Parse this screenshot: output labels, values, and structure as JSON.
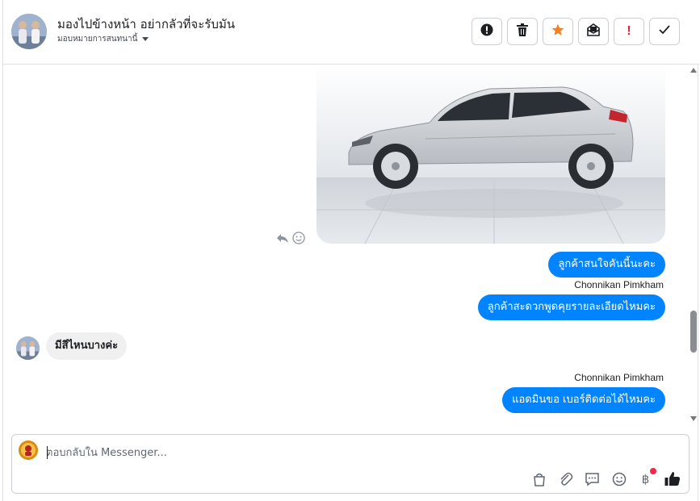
{
  "header": {
    "title": "มองไปข้างหน้า อย่ากลัวที่จะรับมัน",
    "subtitle": "มอบหมายการสนทนานี้",
    "actions": [
      {
        "name": "report-spam-button",
        "icon": "alert-circle-icon"
      },
      {
        "name": "delete-button",
        "icon": "trash-icon"
      },
      {
        "name": "star-button",
        "icon": "star-icon",
        "color": "#f5821f"
      },
      {
        "name": "mark-unread-button",
        "icon": "envelope-icon"
      },
      {
        "name": "mark-important-button",
        "label": "!",
        "color": "#e41e3f"
      },
      {
        "name": "mark-done-button",
        "icon": "check-icon"
      }
    ]
  },
  "messages": {
    "out_1": "ลูกค้าสนใจคันนี้นะคะ",
    "sender_1": "Chonnikan Pimkham",
    "out_2": "ลูกค้าสะดวกพูดคุยรายละเอียดไหมคะ",
    "in_1": "มีสีไหนบางค่ะ",
    "sender_2": "Chonnikan Pimkham",
    "out_3": "แอดมินขอ เบอร์ติดต่อได้ไหมคะ"
  },
  "composer": {
    "placeholder": "ตอบกลับใน Messenger...",
    "tools": [
      "shopping-bag-icon",
      "paperclip-icon",
      "saved-reply-icon",
      "emoji-icon",
      "baht-icon",
      "like-icon"
    ],
    "baht_symbol": "฿"
  },
  "colors": {
    "accent": "#0084ff",
    "star": "#f5821f",
    "danger": "#e41e3f"
  }
}
